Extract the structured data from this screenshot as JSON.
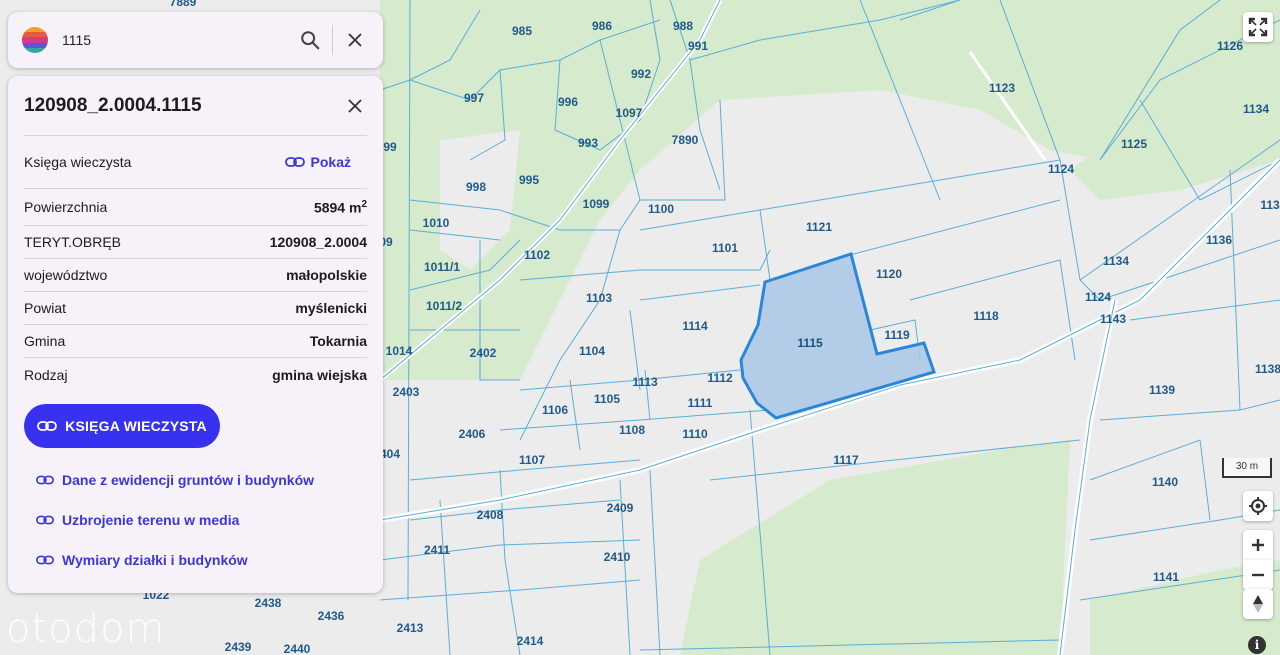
{
  "search": {
    "query": "1115"
  },
  "panel": {
    "title": "120908_2.0004.1115",
    "rows": [
      {
        "label": "Księga wieczysta",
        "link": "Pokaż"
      },
      {
        "label": "Powierzchnia",
        "value": "5894 m",
        "sup": "2"
      },
      {
        "label": "TERYT.OBRĘB",
        "value": "120908_2.0004"
      },
      {
        "label": "województwo",
        "value": "małopolskie"
      },
      {
        "label": "Powiat",
        "value": "myślenicki"
      },
      {
        "label": "Gmina",
        "value": "Tokarnia"
      },
      {
        "label": "Rodzaj",
        "value": "gmina wiejska"
      }
    ],
    "primary_button": "KSIĘGA WIECZYSTA",
    "links": [
      "Dane z ewidencji gruntów i budynków",
      "Uzbrojenie terenu w media",
      "Wymiary działki i budynków"
    ]
  },
  "map": {
    "scale": "30 m",
    "watermark": "otodom",
    "selected_parcel": "1115",
    "colors": {
      "forest": "#d8ebd0",
      "open": "#ededed",
      "boundary": "#5aaed8",
      "selected_fill": "#a9c8e8",
      "selected_stroke": "#2b86d8"
    },
    "labels": [
      "7889",
      "985",
      "986",
      "988",
      "991",
      "1126",
      "992",
      "997",
      "996",
      "1097",
      "1123",
      "1134",
      "7890",
      "993",
      "1125",
      "998",
      "995",
      "1124",
      "1099",
      "1100",
      "1121",
      "113",
      "1010",
      "1101",
      "1136",
      "1102",
      "1011/1",
      "1120",
      "1134",
      "1103",
      "1011/2",
      "1124",
      "1143",
      "1118",
      "1114",
      "1119",
      "1115",
      "1014",
      "2402",
      "1104",
      "1113",
      "1112",
      "1139",
      "2403",
      "1138",
      "1105",
      "1111",
      "1106",
      "2406",
      "1108",
      "1110",
      "1117",
      "1107",
      "1140",
      "2408",
      "2409",
      "2411",
      "2410",
      "1022",
      "2438",
      "2436",
      "1141",
      "2413",
      "2414",
      "2439",
      "2440",
      "99",
      "09",
      "404"
    ]
  }
}
